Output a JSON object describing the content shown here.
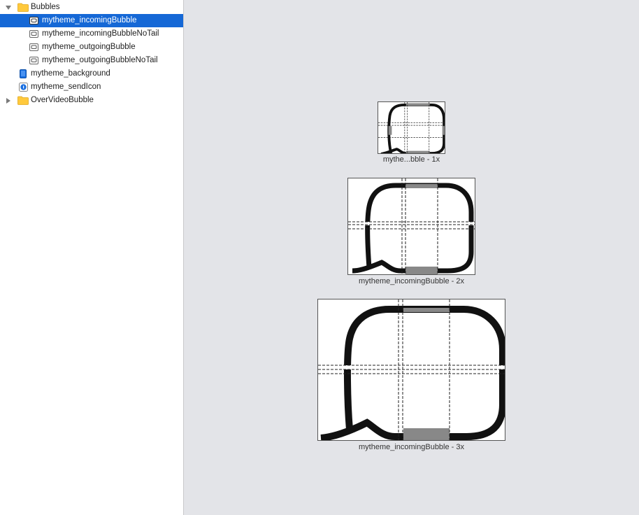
{
  "sidebar": {
    "group": {
      "label": "Bubbles",
      "icon": "folder-icon",
      "disclosure": "disclosure-open-icon"
    },
    "items": [
      {
        "label": "mytheme_incomingBubble",
        "icon": "image-set-icon",
        "selected": true
      },
      {
        "label": "mytheme_incomingBubbleNoTail",
        "icon": "image-set-icon",
        "selected": false
      },
      {
        "label": "mytheme_outgoingBubble",
        "icon": "image-set-icon",
        "selected": false
      },
      {
        "label": "mytheme_outgoingBubbleNoTail",
        "icon": "image-set-icon",
        "selected": false
      }
    ],
    "background_item": {
      "label": "mytheme_background",
      "icon": "phone-icon"
    },
    "sendicon_item": {
      "label": "mytheme_sendIcon",
      "icon": "circle-i-icon"
    },
    "collapsed_group": {
      "label": "OverVideoBubble",
      "icon": "folder-icon",
      "disclosure": "disclosure-closed-icon"
    }
  },
  "wells": [
    {
      "caption": "mythe...bble - 1x"
    },
    {
      "caption": "mytheme_incomingBubble - 2x"
    },
    {
      "caption": "mytheme_incomingBubble - 3x"
    }
  ],
  "colors": {
    "selection": "#1568d6",
    "canvas": "#e3e4e8",
    "folder": "#ffc93c"
  }
}
